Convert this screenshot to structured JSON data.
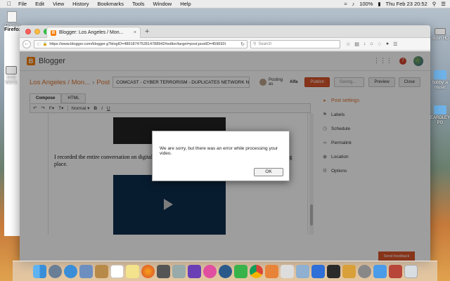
{
  "menubar": {
    "app": "Firefox",
    "items": [
      "File",
      "Edit",
      "View",
      "History",
      "Bookmarks",
      "Tools",
      "Window",
      "Help"
    ],
    "battery": "100%",
    "clock": "Thu Feb 23  20:52"
  },
  "desktop": {
    "icons": [
      {
        "label": "JTH Res"
      },
      {
        "label": "GSS WS71"
      },
      {
        "label": "ntosh HD"
      },
      {
        "label": "bobby .e music"
      },
      {
        "label": "EARDLEY PG"
      }
    ]
  },
  "browser": {
    "tab_title": "Blogger: Los Angeles / Mon...",
    "url": "https://www.blogger.com/blogger.g?blogID=4891874752814788942#editor/target=post;postID=459692t",
    "search_placeholder": "Search"
  },
  "blogger": {
    "brand": "Blogger",
    "notifications": "7",
    "breadcrumb_blog": "Los Angeles / Mon...",
    "breadcrumb_post": "Post",
    "post_title": "COMCAST - CYBER TERRORISM - DUPLICATES NETWORK NAME",
    "posting_as_label": "Posting as",
    "posting_as_user": "Alfa",
    "publish": "Publish",
    "saving": "Saving...",
    "preview": "Preview",
    "close": "Close",
    "mode_compose": "Compose",
    "mode_html": "HTML",
    "format_select": "Normal",
    "body_text": "I recorded the entire conversation on digital audio so I can trace the exact time when the video was taking place.",
    "sidebar": {
      "post_settings": "Post settings",
      "labels": "Labels",
      "schedule": "Schedule",
      "permalink": "Permalink",
      "location": "Location",
      "options": "Options"
    },
    "send_feedback": "Send feedback"
  },
  "dialog": {
    "message": "We are sorry, but there was an error while processing your video.",
    "ok": "OK"
  },
  "colors": {
    "accent": "#d9542b",
    "blogger_orange": "#f57d00"
  }
}
